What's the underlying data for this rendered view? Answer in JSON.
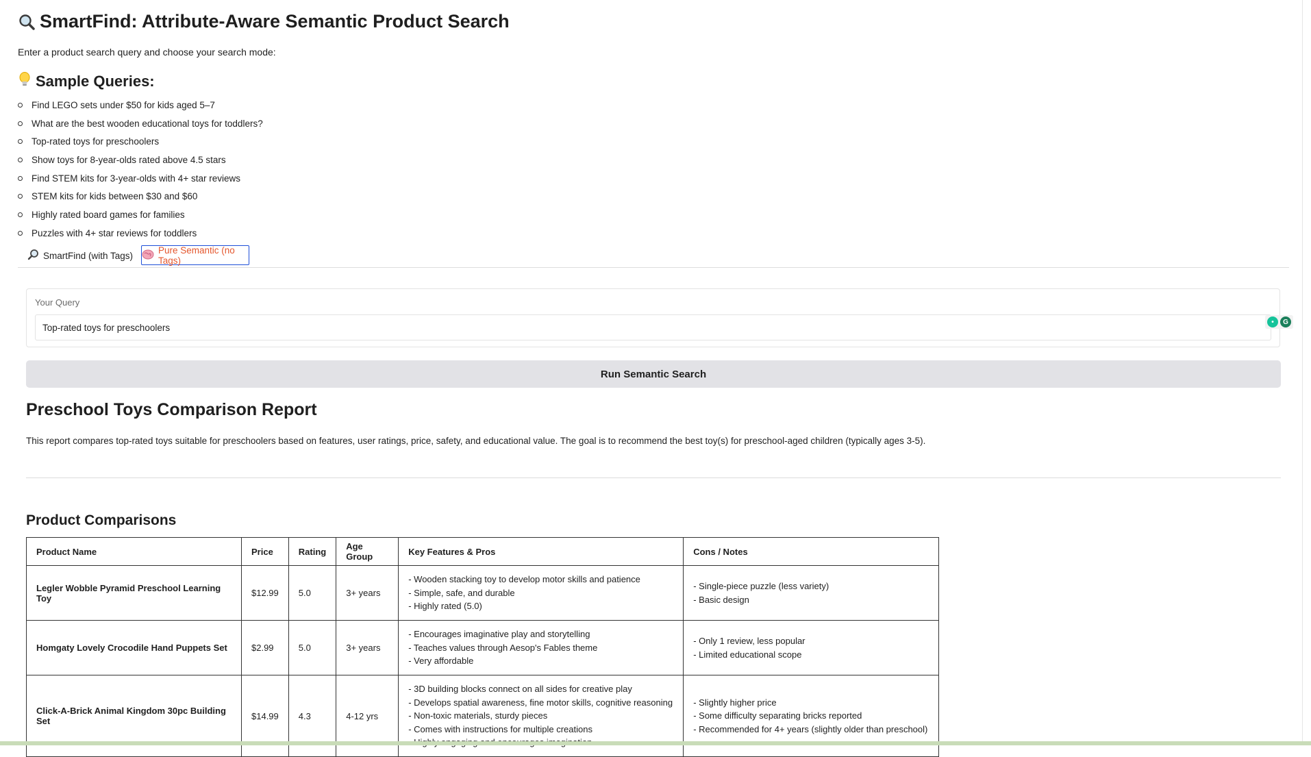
{
  "header": {
    "title": "SmartFind: Attribute-Aware Semantic Product Search",
    "title_icon": "magnifying-glass-icon",
    "intro": "Enter a product search query and choose your search mode:"
  },
  "samples": {
    "heading": "Sample Queries:",
    "heading_icon": "lightbulb-icon",
    "items": [
      "Find LEGO sets under $50 for kids aged 5–7",
      "What are the best wooden educational toys for toddlers?",
      "Top-rated toys for preschoolers",
      "Show toys for 8-year-olds rated above 4.5 stars",
      "Find STEM kits for 3-year-olds with 4+ star reviews",
      "STEM kits for kids between $30 and $60",
      "Highly rated board games for families",
      "Puzzles with 4+ star reviews for toddlers"
    ]
  },
  "tabs": [
    {
      "label": "SmartFind (with Tags)",
      "icon": "magnifying-glass-icon",
      "active": false
    },
    {
      "label": "Pure Semantic (no Tags)",
      "icon": "brain-icon",
      "active": true
    }
  ],
  "query": {
    "label": "Your Query",
    "value": "Top-rated toys for preschoolers"
  },
  "run_button": "Run Semantic Search",
  "report": {
    "title": "Preschool Toys Comparison Report",
    "description": "This report compares top-rated toys suitable for preschoolers based on features, user ratings, price, safety, and educational value. The goal is to recommend the best toy(s) for preschool-aged children (typically ages 3-5).",
    "comparisons_title": "Product Comparisons",
    "columns": [
      "Product Name",
      "Price",
      "Rating",
      "Age Group",
      "Key Features & Pros",
      "Cons / Notes"
    ],
    "rows": [
      {
        "name": "Legler Wobble Pyramid Preschool Learning Toy",
        "price": "$12.99",
        "rating": "5.0",
        "age": "3+ years",
        "pros": [
          "- Wooden stacking toy to develop motor skills and patience",
          "- Simple, safe, and durable",
          "- Highly rated (5.0)"
        ],
        "cons": [
          "- Single-piece puzzle (less variety)",
          "- Basic design"
        ]
      },
      {
        "name": "Homgaty Lovely Crocodile Hand Puppets Set",
        "price": "$2.99",
        "rating": "5.0",
        "age": "3+ years",
        "pros": [
          "- Encourages imaginative play and storytelling",
          "- Teaches values through Aesop's Fables theme",
          "- Very affordable"
        ],
        "cons": [
          "- Only 1 review, less popular",
          "- Limited educational scope"
        ]
      },
      {
        "name": "Click-A-Brick Animal Kingdom 30pc Building Set",
        "price": "$14.99",
        "rating": "4.3",
        "age": "4-12 yrs",
        "pros": [
          "- 3D building blocks connect on all sides for creative play",
          "- Develops spatial awareness, fine motor skills, cognitive reasoning",
          "- Non-toxic materials, sturdy pieces",
          "- Comes with instructions for multiple creations",
          "- Highly engaging and encourages imagination"
        ],
        "cons": [
          "- Slightly higher price",
          "- Some difficulty separating bricks reported",
          "- Recommended for 4+ years (slightly older than preschool)"
        ]
      }
    ]
  }
}
